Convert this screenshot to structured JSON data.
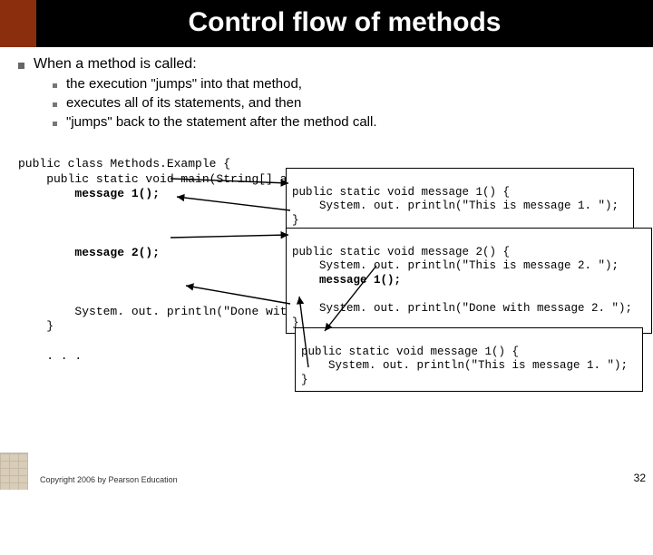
{
  "title": "Control flow of methods",
  "lead": "When a method is called:",
  "bullets": [
    "the execution \"jumps\" into that method,",
    "executes all of its statements, and then",
    "\"jumps\" back to the statement after the method call."
  ],
  "code": {
    "l1": "public class Methods.Example {",
    "l2": "    public static void main(String[] args) {",
    "l3_call1": "        message 1();",
    "l3_call2": "        message 2();",
    "l4": "        System. out. println(\"Done with main.\");",
    "l5": "    }",
    "l6": "    . . ."
  },
  "box1": {
    "a": "public static void message 1() {",
    "b": "    System. out. println(\"This is message 1. \");",
    "c": "}"
  },
  "box2": {
    "a": "public static void message 2() {",
    "b": "    System. out. println(\"This is message 2. \");",
    "c": "    message 1();",
    "d": "    System. out. println(\"Done with message 2. \");",
    "e": "}"
  },
  "box3": {
    "a": "public static void message 1() {",
    "b": "    System. out. println(\"This is message 1. \");",
    "c": "}"
  },
  "footer": "Copyright 2006 by Pearson Education",
  "page": "32"
}
